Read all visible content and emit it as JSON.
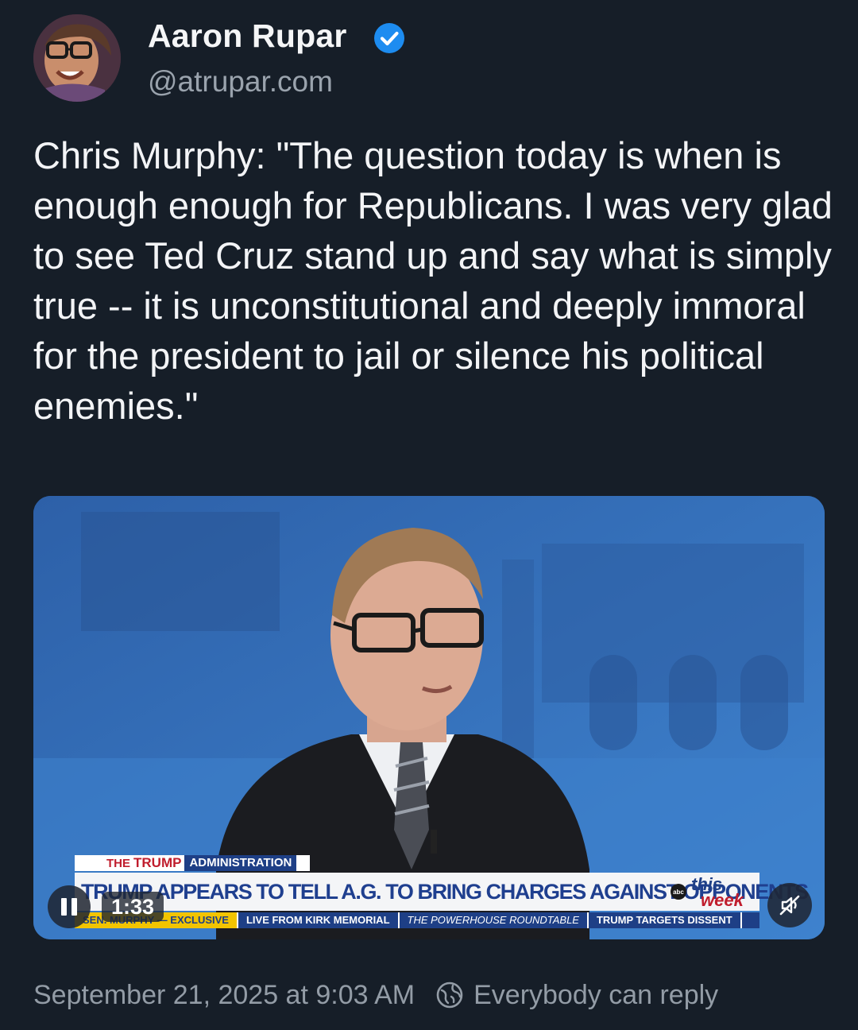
{
  "post": {
    "author_name": "Aaron Rupar",
    "handle": "@atrupar.com",
    "text": "Chris Murphy: \"The question today is when is enough enough for Republicans. I was very glad to see Ted Cruz stand up and say what is simply true -- it is unconstitutional and deeply immoral for the president to jail or silence his political enemies.\"",
    "timestamp": "September 21, 2025 at 9:03 AM",
    "reply_setting": "Everybody can reply"
  },
  "video": {
    "time_remaining": "1:33",
    "lower_third": {
      "kicker_the": "THE",
      "kicker_trump": "TRUMP",
      "kicker_section": "ADMINISTRATION",
      "headline": "TRUMP APPEARS TO TELL A.G. TO BRING CHARGES AGAINST OPPONENTS",
      "ticker": [
        "SEN. MURPHY — EXCLUSIVE",
        "LIVE FROM KIRK MEMORIAL",
        "THE POWERHOUSE ROUNDTABLE",
        "TRUMP TARGETS DISSENT"
      ],
      "show_logo_line1": "this",
      "show_logo_line2": "week",
      "network": "abc"
    }
  },
  "icons": {
    "verified": "verified-badge-icon",
    "pause": "pause-icon",
    "mute": "speaker-muted-icon",
    "reply_scope": "globe-icon"
  },
  "colors": {
    "background": "#161e28",
    "verified_blue": "#1d8cf0",
    "secondary_text": "#939ca6",
    "abc_navy": "#1e3f86",
    "abc_red": "#c01d2d"
  }
}
